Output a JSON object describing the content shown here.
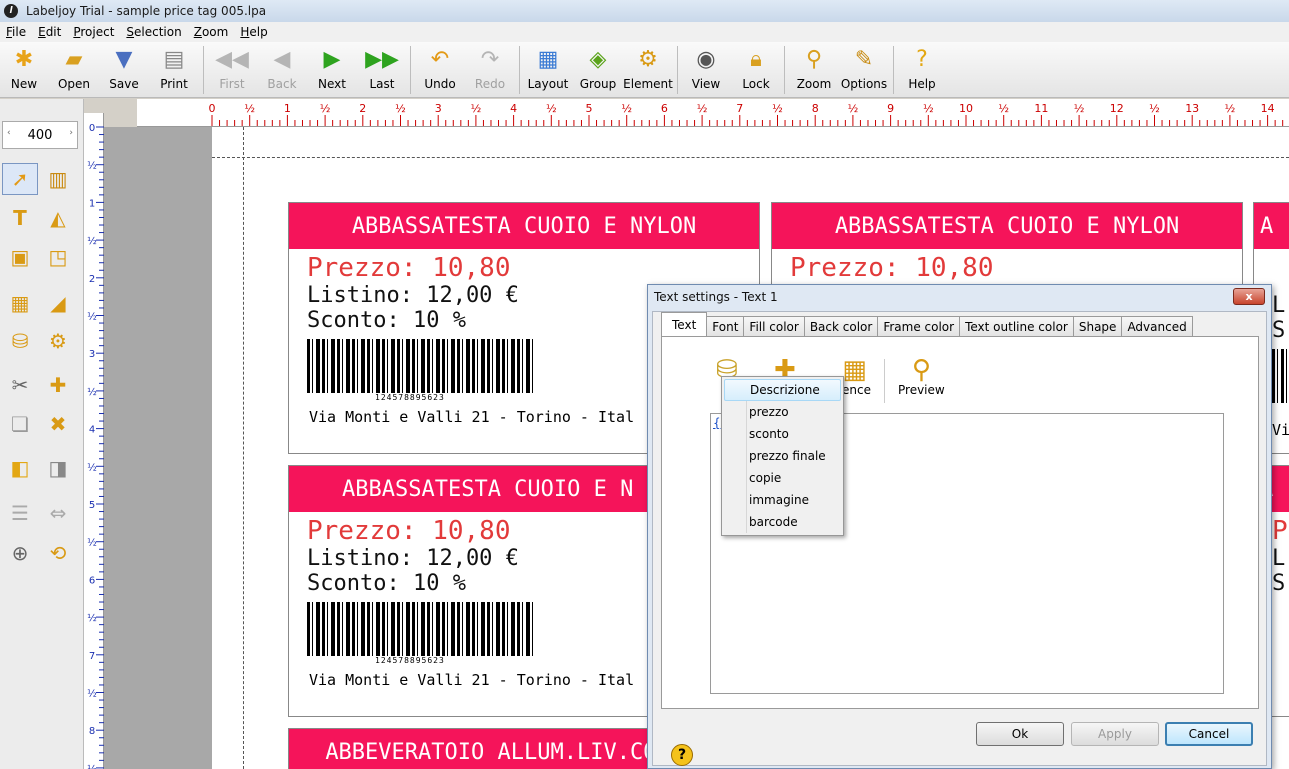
{
  "window": {
    "title": "Labeljoy Trial - sample price tag 005.lpa"
  },
  "menu": [
    "File",
    "Edit",
    "Project",
    "Selection",
    "Zoom",
    "Help"
  ],
  "toolbar": {
    "new": "New",
    "open": "Open",
    "save": "Save",
    "print": "Print",
    "first": "First",
    "back": "Back",
    "next": "Next",
    "last": "Last",
    "undo": "Undo",
    "redo": "Redo",
    "layout": "Layout",
    "group": "Group",
    "element": "Element",
    "view": "View",
    "lock": "Lock",
    "zoom": "Zoom",
    "options": "Options",
    "help": "Help"
  },
  "zoom": {
    "value": "400"
  },
  "ruler": {
    "h_ticks": [
      "0",
      "½",
      "1",
      "½",
      "2",
      "½",
      "3",
      "½",
      "4",
      "½",
      "5",
      "½",
      "6",
      "½",
      "7",
      "½",
      "8",
      "½",
      "9",
      "½",
      "10",
      "½",
      "11",
      "½",
      "12",
      "½",
      "13",
      "½",
      "14"
    ],
    "v_ticks": [
      "0",
      "½",
      "1",
      "½",
      "2",
      "½",
      "3",
      "½",
      "4",
      "½",
      "5",
      "½",
      "6",
      "½",
      "7",
      "½",
      "8",
      "½"
    ]
  },
  "labels": {
    "header": "ABBASSATESTA CUOIO E NYLON",
    "header_partial": "ABBASSATESTA CUOIO E N",
    "header_bottom": "ABBEVERATOIO ALLUM.LIV.COSTAN.",
    "price": "Prezzo: 10,80",
    "list": "Listino: 12,00 €",
    "discount": "Sconto: 10 %",
    "barcode_number": "124578895623",
    "address": "Via Monti e Valli 21 - Torino - Ital",
    "right_edge": {
      "letter_hdr": "A",
      "letter_price": "P",
      "letter_list": "L",
      "letter_disc": "S",
      "addr_tail": "Vi"
    }
  },
  "dialog": {
    "title": "Text settings - Text 1",
    "close": "x",
    "tabs": [
      "Text",
      "Font",
      "Fill color",
      "Back color",
      "Frame color",
      "Text outline color",
      "Shape",
      "Advanced"
    ],
    "tools": {
      "reference": "erence",
      "preview": "Preview"
    },
    "field_ref": "{De",
    "buttons": {
      "ok": "Ok",
      "apply": "Apply",
      "cancel": "Cancel"
    }
  },
  "context_menu": [
    "Descrizione",
    "prezzo",
    "sconto",
    "prezzo finale",
    "copie",
    "immagine",
    "barcode"
  ],
  "colors": {
    "label_header": "#f5145a",
    "price": "#e23a3a",
    "ruler_numbers": "#cc0000"
  }
}
